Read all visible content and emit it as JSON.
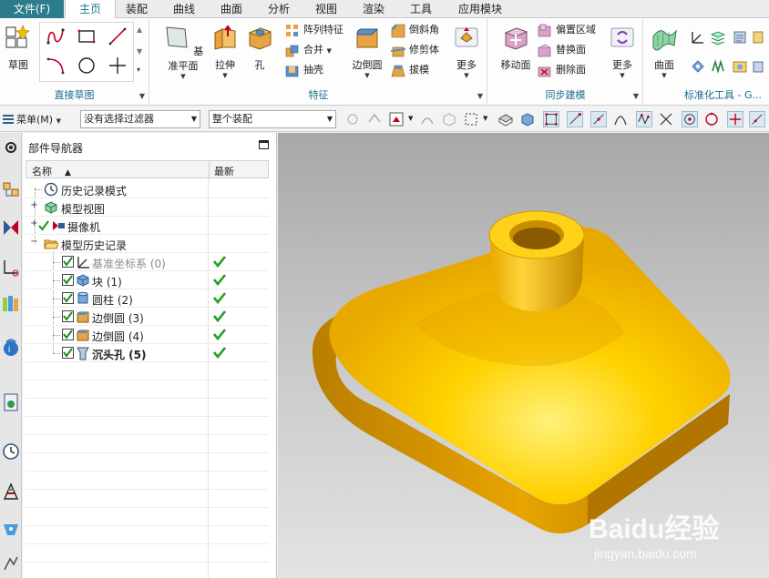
{
  "menu_tabs": {
    "file": "文件(F)",
    "tabs": [
      "主页",
      "装配",
      "曲线",
      "曲面",
      "分析",
      "视图",
      "渲染",
      "工具",
      "应用模块"
    ],
    "active": "主页"
  },
  "ribbon": {
    "direct_sketch": {
      "label": "直接草图",
      "sketch_button": "草图"
    },
    "feature": {
      "label": "特征",
      "datum_plane": "基准平面",
      "extrude": "拉伸",
      "hole": "孔",
      "pattern_feature": "阵列特征",
      "unite": "合并",
      "shell": "抽壳",
      "edge_blend": "边倒圆",
      "chamfer": "倒斜角",
      "trim_body": "修剪体",
      "draft": "拔模",
      "more": "更多"
    },
    "sync_modeling": {
      "label": "同步建模",
      "move_face": "移动面",
      "offset_region": "偏置区域",
      "replace_face": "替换面",
      "delete_face": "删除面",
      "more": "更多"
    },
    "standard_tools": {
      "label": "标准化工具 - G...",
      "surface": "曲面"
    }
  },
  "toolbar": {
    "menu": "菜单(M)",
    "filter_value": "没有选择过滤器",
    "scope_value": "整个装配"
  },
  "navigator": {
    "title": "部件导航器",
    "col_name": "名称",
    "col_latest": "最新",
    "items": [
      {
        "label": "历史记录模式"
      },
      {
        "label": "模型视图"
      },
      {
        "label": "摄像机"
      },
      {
        "label": "模型历史记录"
      },
      {
        "label": "基准坐标系 (0)"
      },
      {
        "label": "块 (1)"
      },
      {
        "label": "圆柱 (2)"
      },
      {
        "label": "边倒圆 (3)"
      },
      {
        "label": "边倒圆 (4)"
      },
      {
        "label": "沉头孔 (5)"
      }
    ]
  },
  "watermark": {
    "logo": "Baidu经验",
    "url": "jingyan.baidu.com"
  },
  "colors": {
    "accent": "#2b7c8c",
    "part_yellow": "#f2b600",
    "check_green": "#22a022"
  }
}
